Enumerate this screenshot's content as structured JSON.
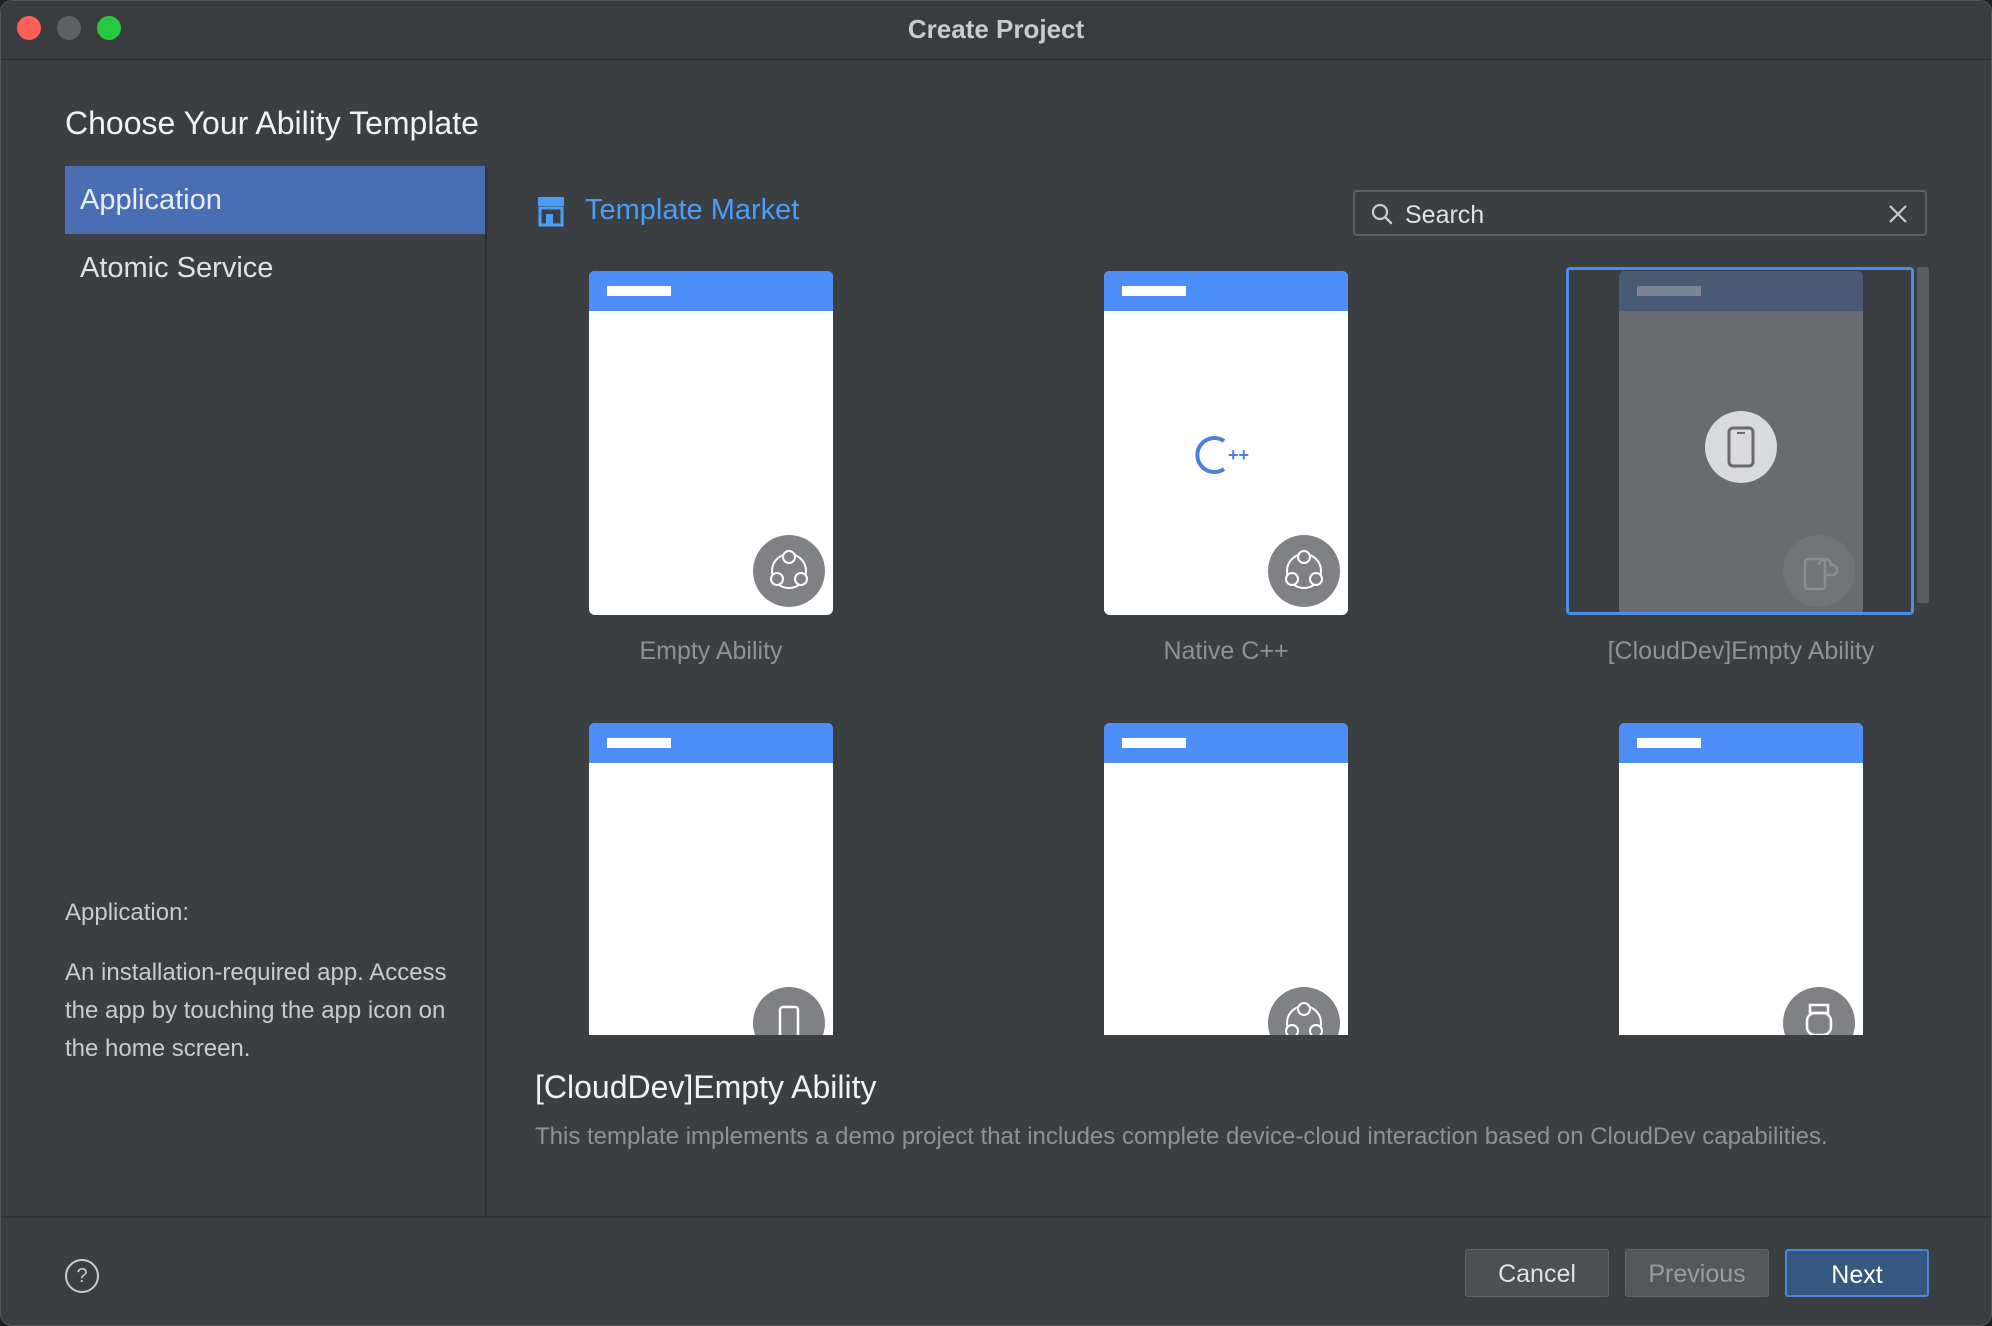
{
  "window": {
    "title": "Create Project"
  },
  "heading": "Choose Your Ability Template",
  "sidebar": {
    "items": [
      {
        "label": "Application",
        "selected": true
      },
      {
        "label": "Atomic Service",
        "selected": false
      }
    ],
    "description_title": "Application:",
    "description": "An installation-required app. Access the app by touching the app icon on the home screen."
  },
  "market": {
    "label": "Template Market",
    "icon": "store-icon"
  },
  "search": {
    "value": "Search",
    "placeholder": "Search"
  },
  "templates": [
    {
      "label": "Empty Ability",
      "badge_icon": "connect-nodes-icon",
      "center_icon": ""
    },
    {
      "label": "Native C++",
      "badge_icon": "connect-nodes-icon",
      "center_icon": "cpp-icon"
    },
    {
      "label": "[CloudDev]Empty Ability",
      "badge_icon": "cloud-device-icon",
      "center_icon": "phone-icon",
      "selected": true
    },
    {
      "label": "",
      "badge_icon": "phone-icon"
    },
    {
      "label": "",
      "badge_icon": "connect-nodes-icon"
    },
    {
      "label": "",
      "badge_icon": "watch-icon"
    }
  ],
  "selected_template": {
    "name": "[CloudDev]Empty Ability",
    "description": "This template implements a demo project that includes complete device-cloud interaction based on CloudDev capabilities."
  },
  "buttons": {
    "help": "?",
    "cancel": "Cancel",
    "previous": "Previous",
    "next": "Next"
  },
  "colors": {
    "accent": "#4b9dfb",
    "selection": "#4a6eb3",
    "card_bar": "#4d8ef9"
  }
}
